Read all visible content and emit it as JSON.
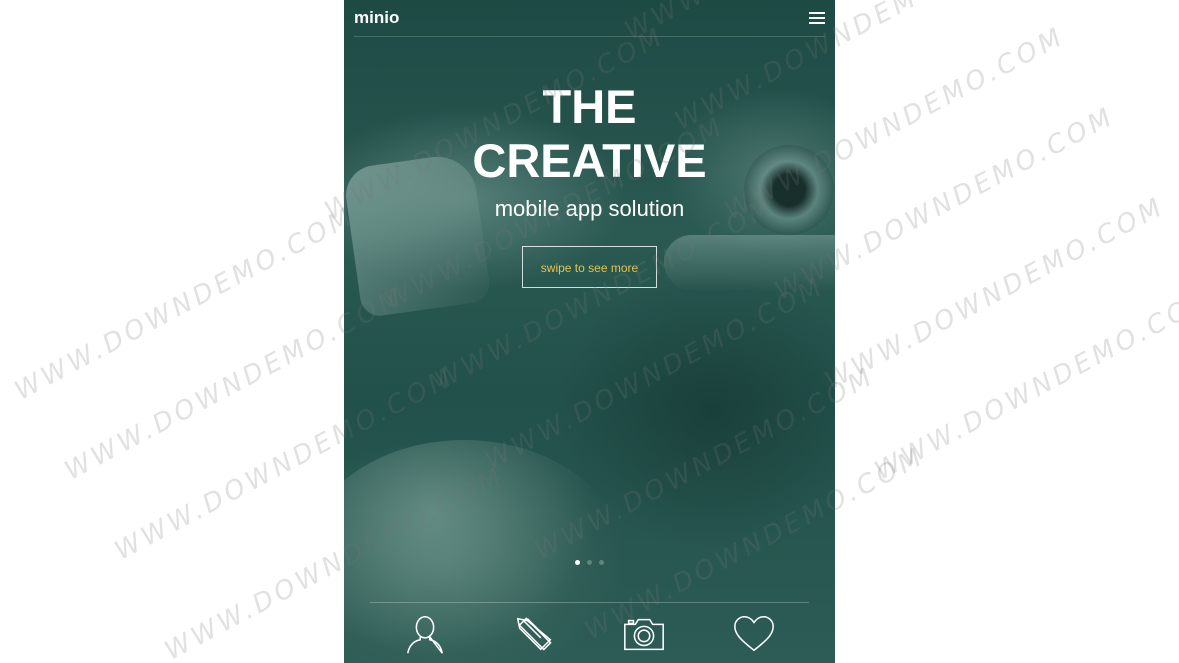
{
  "app": {
    "logo": "minio"
  },
  "header": {
    "menu_icon": "hamburger-menu-icon"
  },
  "hero": {
    "title_line1": "THE",
    "title_line2": "CREATIVE",
    "subtitle": "mobile app solution",
    "cta_label": "swipe to see more"
  },
  "slider": {
    "total_slides": 3,
    "active_slide": 1
  },
  "bottom_nav": {
    "items": [
      {
        "icon": "user-icon"
      },
      {
        "icon": "pencil-ruler-icon"
      },
      {
        "icon": "camera-icon"
      },
      {
        "icon": "heart-icon"
      }
    ]
  },
  "watermark": {
    "text": "WWW.DOWNDEMO.COM"
  },
  "colors": {
    "overlay": "#1e4a44",
    "cta_text": "#e7c24a",
    "text": "#ffffff"
  }
}
